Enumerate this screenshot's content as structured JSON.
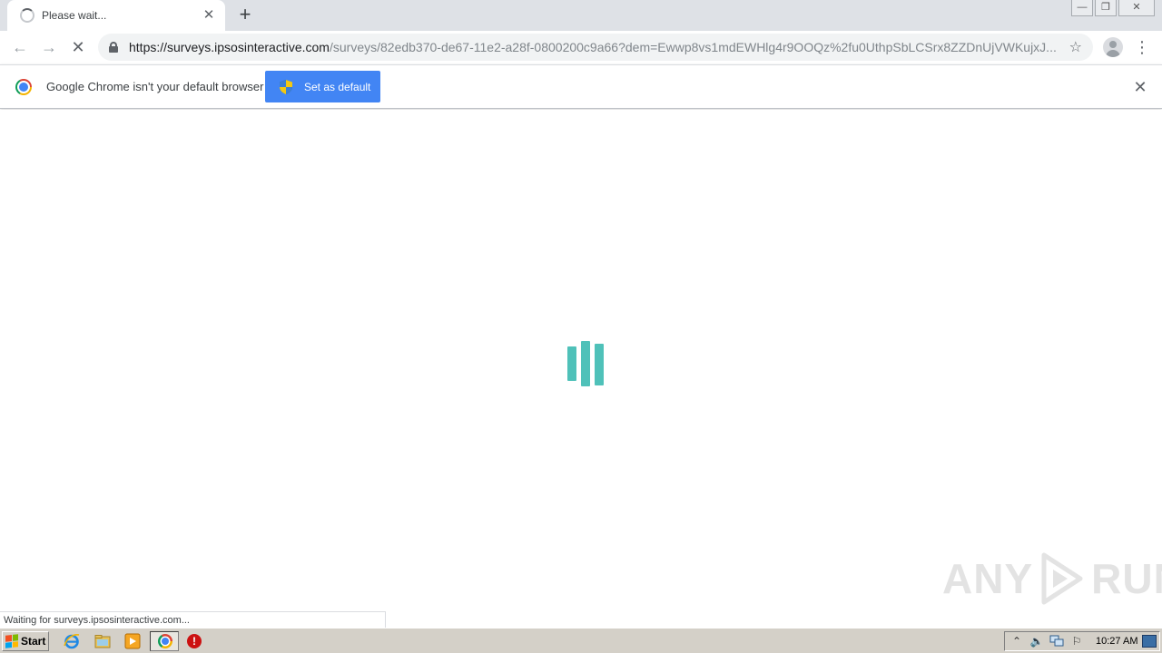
{
  "tab": {
    "title": "Please wait...",
    "close_glyph": "✕",
    "new_tab_glyph": "+"
  },
  "window_controls": {
    "minimize_glyph": "—",
    "restore_glyph": "❐",
    "close_glyph": "✕"
  },
  "toolbar": {
    "back_glyph": "←",
    "forward_glyph": "→",
    "stop_glyph": "✕",
    "url_host": "https://surveys.ipsosinteractive.com",
    "url_path": "/surveys/82edb370-de67-11e2-a28f-0800200c9a66?dem=Ewwp8vs1mdEWHlg4r9OOQz%2fu0UthpSbLCSrx8ZZDnUjVWKujxJ...",
    "star_glyph": "☆",
    "menu_glyph": "⋮"
  },
  "infobar": {
    "message": "Google Chrome isn't your default browser",
    "button_label": "Set as default",
    "close_glyph": "✕"
  },
  "content": {
    "loader_color": "#4fc1b9",
    "watermark_left": "ANY",
    "watermark_right": "RUN"
  },
  "status": {
    "text": "Waiting for surveys.ipsosinteractive.com..."
  },
  "taskbar": {
    "start_label": "Start",
    "stop_glyph": "!",
    "tray_arrow_glyph": "⌃",
    "tray_volume_glyph": "🔈",
    "tray_flag_glyph": "⚐",
    "clock": "10:27 AM"
  },
  "icons": {
    "tab_spinner": "loading-spinner-icon",
    "chrome": "chrome-logo-icon",
    "shield": "uac-shield-icon"
  },
  "colors": {
    "accent_button": "#4285f4",
    "tabstrip": "#dee1e6",
    "taskbar": "#d4d0c8"
  }
}
